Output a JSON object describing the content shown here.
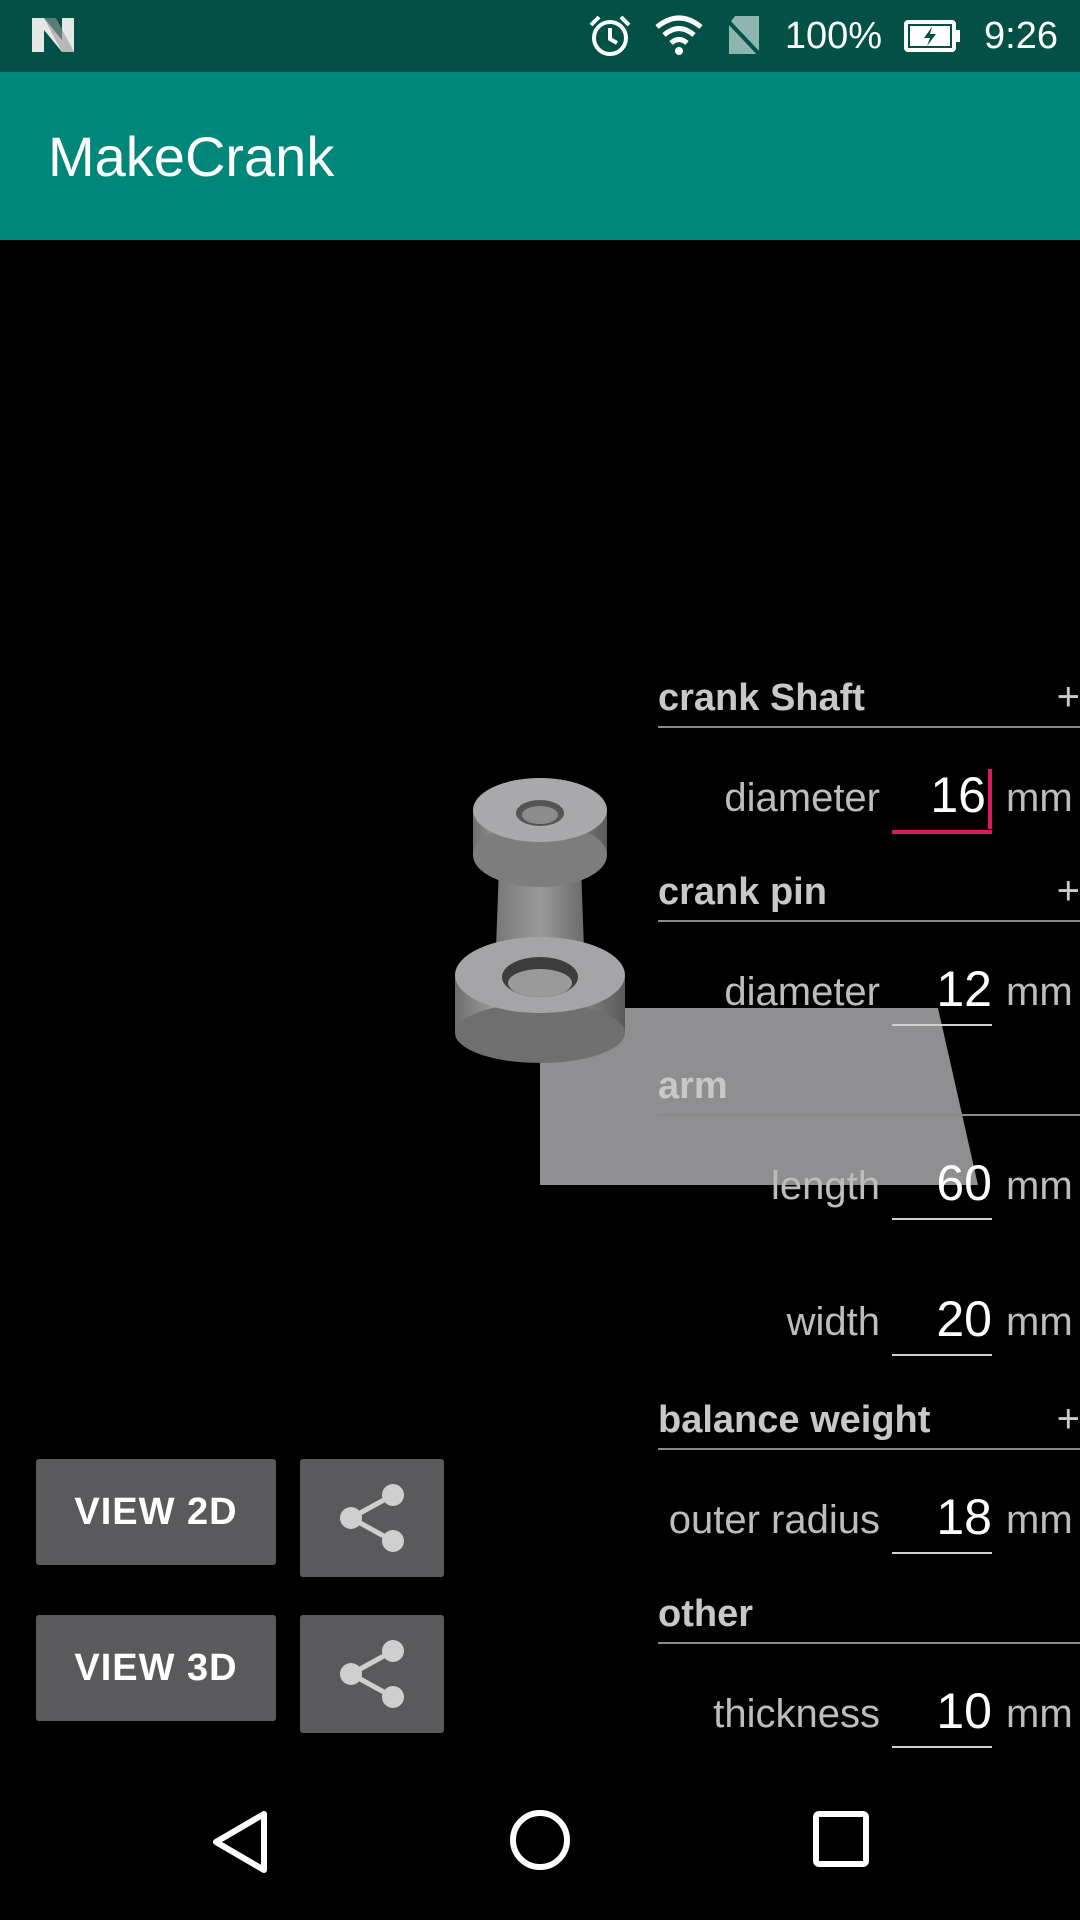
{
  "status_bar": {
    "battery_percent": "100%",
    "time": "9:26",
    "icons": [
      "n-logo-icon",
      "alarm-icon",
      "wifi-icon",
      "no-sim-icon",
      "battery-charging-icon"
    ]
  },
  "app_bar": {
    "title": "MakeCrank"
  },
  "sections": {
    "crank_shaft": {
      "label": "crank Shaft",
      "toggle": "+"
    },
    "crank_pin": {
      "label": "crank pin",
      "toggle": "+"
    },
    "arm": {
      "label": "arm"
    },
    "balance_weight": {
      "label": "balance weight",
      "toggle": "+"
    },
    "other": {
      "label": "other"
    }
  },
  "params": {
    "shaft_diameter": {
      "label": "diameter",
      "value": "16",
      "unit": "mm"
    },
    "pin_diameter": {
      "label": "diameter",
      "value": "12",
      "unit": "mm"
    },
    "arm_length": {
      "label": "length",
      "value": "60",
      "unit": "mm"
    },
    "arm_width": {
      "label": "width",
      "value": "20",
      "unit": "mm"
    },
    "outer_radius": {
      "label": "outer radius",
      "value": "18",
      "unit": "mm"
    },
    "thickness": {
      "label": "thickness",
      "value": "10",
      "unit": "mm"
    }
  },
  "buttons": {
    "view_2d": "VIEW 2D",
    "view_3d": "VIEW 3D",
    "share_icon": "share-icon"
  },
  "nav_bar": {
    "icons": [
      "back-icon",
      "home-icon",
      "recents-icon"
    ]
  },
  "colors": {
    "status_bar": "#035046",
    "app_bar": "#00877a",
    "accent": "#d81b60",
    "button": "#5a5a5c"
  }
}
